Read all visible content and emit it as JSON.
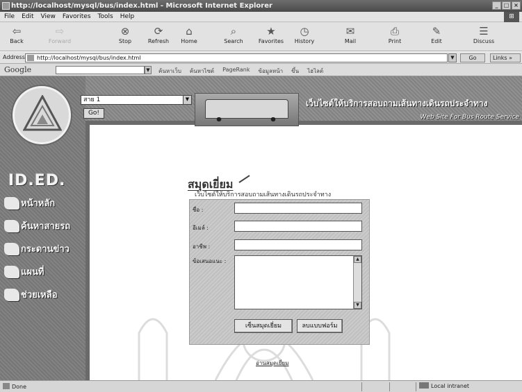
{
  "window": {
    "title": "http://localhost/mysql/bus/index.html - Microsoft Internet Explorer",
    "controls": [
      "_",
      "□",
      "×"
    ]
  },
  "menu": [
    "File",
    "Edit",
    "View",
    "Favorites",
    "Tools",
    "Help"
  ],
  "toolbar": [
    {
      "label": "Back",
      "icon": "back-arrow-icon",
      "glyph": "⇦",
      "enabled": true
    },
    {
      "label": "Forward",
      "icon": "forward-arrow-icon",
      "glyph": "⇨",
      "enabled": false
    },
    {
      "label": "Stop",
      "icon": "stop-icon",
      "glyph": "⊗",
      "enabled": true
    },
    {
      "label": "Refresh",
      "icon": "refresh-icon",
      "glyph": "⟳",
      "enabled": true
    },
    {
      "label": "Home",
      "icon": "home-icon",
      "glyph": "⌂",
      "enabled": true
    },
    {
      "label": "Search",
      "icon": "search-icon",
      "glyph": "⌕",
      "enabled": true
    },
    {
      "label": "Favorites",
      "icon": "favorites-icon",
      "glyph": "★",
      "enabled": true
    },
    {
      "label": "History",
      "icon": "history-icon",
      "glyph": "◷",
      "enabled": true
    },
    {
      "label": "Mail",
      "icon": "mail-icon",
      "glyph": "✉",
      "enabled": true
    },
    {
      "label": "Print",
      "icon": "print-icon",
      "glyph": "⎙",
      "enabled": true
    },
    {
      "label": "Edit",
      "icon": "edit-icon",
      "glyph": "✎",
      "enabled": true
    },
    {
      "label": "Discuss",
      "icon": "discuss-icon",
      "glyph": "☰",
      "enabled": true
    }
  ],
  "address": {
    "label": "Address",
    "url": "http://localhost/mysql/bus/index.html",
    "go": "Go",
    "links": "Links »"
  },
  "google_bar": {
    "logo": "Google",
    "items": [
      "ค้นหาเว็บ",
      "ค้นหาไซต์",
      "PageRank",
      "ข้อมูลหน้า",
      "ขึ้น",
      "ไฮไลต์"
    ]
  },
  "site": {
    "brand": "ID.ED.",
    "route_select": "สาย 1",
    "go_button": "Go!",
    "banner_title": "เว็บไซต์ให้บริการสอบถามเส้นทางเดินรถประจำทาง",
    "banner_subtitle": "Web Site For Bus Route Service",
    "nav": [
      {
        "label": "หน้าหลัก",
        "icon": "home-nav-icon"
      },
      {
        "label": "ค้นหาสายรถ",
        "icon": "search-route-icon"
      },
      {
        "label": "กระดานข่าว",
        "icon": "webboard-icon"
      },
      {
        "label": "แผนที่",
        "icon": "map-icon"
      },
      {
        "label": "ช่วยเหลือ",
        "icon": "help-icon"
      }
    ]
  },
  "guestbook": {
    "heading": "สมุดเยี่ยม",
    "subheading": "เว็บไซต์ให้บริการสอบถามเส้นทางเดินรถประจำทาง",
    "fields": {
      "name": {
        "label": "ชื่อ :",
        "value": ""
      },
      "email": {
        "label": "อีเมล์ :",
        "value": ""
      },
      "occupation": {
        "label": "อาชีพ :",
        "value": ""
      },
      "comment": {
        "label": "ข้อเสนอแนะ :",
        "value": ""
      }
    },
    "submit": "เซ็นสมุดเยี่ยม",
    "reset": "ลบแบบฟอร์ม",
    "view_link": "อ่านสมุดเยี่ยม"
  },
  "status": {
    "text": "Done",
    "zone": "Local intranet"
  }
}
